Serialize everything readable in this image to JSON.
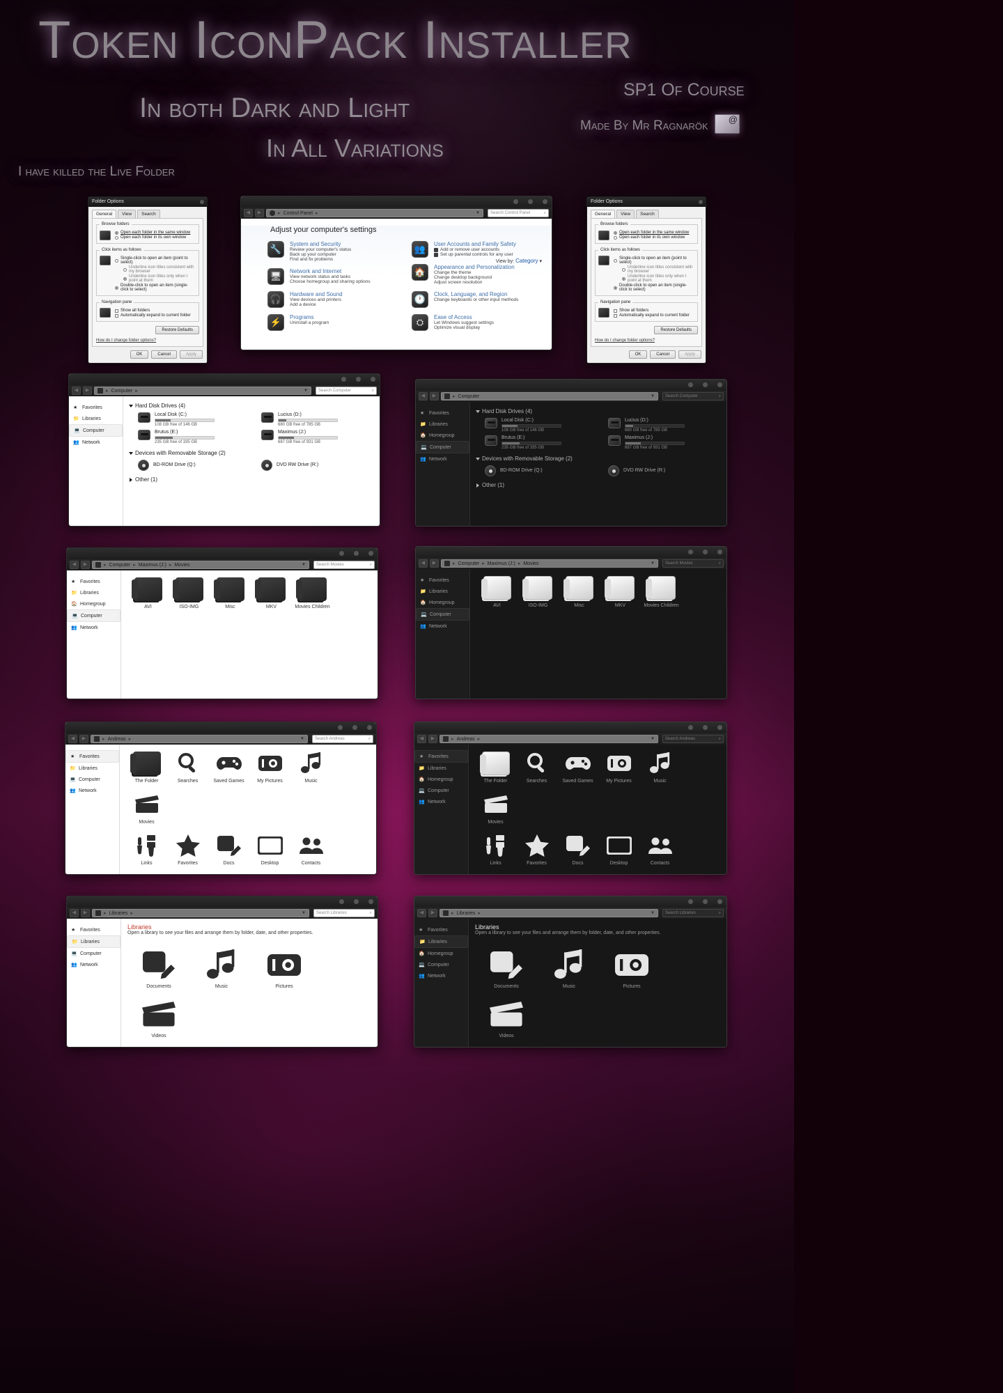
{
  "hero": {
    "title": "Token IconPack Installer",
    "subtitle1": "In both Dark and Light",
    "subtitle2": "In All Variations",
    "sp1": "SP1 Of Course",
    "made_by": "Made By Mr Ragnarök",
    "note": "I have killed the Live Folder"
  },
  "folder_options": {
    "title": "Folder Options",
    "tabs": [
      "General",
      "View",
      "Search"
    ],
    "browse_legend": "Browse folders",
    "browse_opts": [
      "Open each folder in the same window",
      "Open each folder in its own window"
    ],
    "click_legend": "Click items as follows",
    "click_opts": [
      "Single-click to open an item (point to select)",
      "Underline icon titles consistent with my browser",
      "Underline icon titles only when I point at them",
      "Double-click to open an item (single-click to select)"
    ],
    "nav_legend": "Navigation pane",
    "nav_opts": [
      "Show all folders",
      "Automatically expand to current folder"
    ],
    "restore": "Restore Defaults",
    "help": "How do I change folder options?",
    "buttons": [
      "OK",
      "Cancel",
      "Apply"
    ]
  },
  "control_panel": {
    "crumb": "Control Panel",
    "search_placeholder": "Search Control Panel",
    "heading": "Adjust your computer's settings",
    "viewby_label": "View by:",
    "viewby_value": "Category",
    "left": [
      {
        "icon": "wrench-icon",
        "title": "System and Security",
        "links": [
          "Review your computer's status",
          "Back up your computer",
          "Find and fix problems"
        ]
      },
      {
        "icon": "network-icon",
        "title": "Network and Internet",
        "links": [
          "View network status and tasks",
          "Choose homegroup and sharing options"
        ]
      },
      {
        "icon": "headphones-icon",
        "title": "Hardware and Sound",
        "links": [
          "View devices and printers",
          "Add a device"
        ]
      },
      {
        "icon": "bolt-icon",
        "title": "Programs",
        "links": [
          "Uninstall a program"
        ]
      }
    ],
    "right": [
      {
        "icon": "users-icon",
        "title": "User Accounts and Family Safety",
        "links": [
          "Add or remove user accounts",
          "Set up parental controls for any user"
        ],
        "bulleted": true
      },
      {
        "icon": "house-icon",
        "title": "Appearance and Personalization",
        "links": [
          "Change the theme",
          "Change desktop background",
          "Adjust screen resolution"
        ]
      },
      {
        "icon": "clock-icon",
        "title": "Clock, Language, and Region",
        "links": [
          "Change keyboards or other input methods"
        ]
      },
      {
        "icon": "ease-icon",
        "title": "Ease of Access",
        "links": [
          "Let Windows suggest settings",
          "Optimize visual display"
        ]
      }
    ]
  },
  "sidebar_items": [
    {
      "label": "Favorites",
      "icon": "star-icon"
    },
    {
      "label": "Libraries",
      "icon": "library-icon"
    },
    {
      "label": "Homegroup",
      "icon": "house-icon"
    },
    {
      "label": "Computer",
      "icon": "monitor-icon"
    },
    {
      "label": "Network",
      "icon": "people-icon"
    }
  ],
  "computer_window": {
    "crumb": "Computer",
    "search_placeholder": "Search Computer",
    "selected_sidebar": "Computer",
    "group_hdd": "Hard Disk Drives (4)",
    "drives": [
      {
        "name": "Local Disk (C:)",
        "free": "108 GB free of 146 GB",
        "used_pct": 26
      },
      {
        "name": "Lucius (D:)",
        "free": "680 GB free of 785 GB",
        "used_pct": 13
      },
      {
        "name": "Brutus (E:)",
        "free": "235 GB free of 335 GB",
        "used_pct": 30
      },
      {
        "name": "Maximus (J:)",
        "free": "687 GB free of 931 GB",
        "used_pct": 26
      }
    ],
    "group_removable": "Devices with Removable Storage (2)",
    "removable": [
      {
        "name": "BD-ROM Drive (Q:)"
      },
      {
        "name": "DVD RW Drive (R:)"
      }
    ],
    "group_other": "Other (1)"
  },
  "computer_window_sidebar_short": [
    {
      "label": "Favorites"
    },
    {
      "label": "Libraries"
    },
    {
      "label": "Homegroup"
    },
    {
      "label": "Computer"
    },
    {
      "label": "Network"
    }
  ],
  "movies_window": {
    "crumb": "Computer › Maximus (J:) › Movies",
    "crumb_parts": [
      "Computer",
      "Maximus (J:)",
      "Movies"
    ],
    "search_placeholder": "Search Movies",
    "selected_sidebar": "Computer",
    "folders": [
      "AVI",
      "ISO-IMG",
      "Misc",
      "MKV",
      "Movies Children"
    ]
  },
  "andreas_window": {
    "crumb": "Andreas",
    "search_placeholder": "Search Andreas",
    "selected_sidebar": "Favorites",
    "items_row1": [
      {
        "label": "The Folder",
        "icon": "folder-icon"
      },
      {
        "label": "Searches",
        "icon": "magnifier-icon"
      },
      {
        "label": "Saved Games",
        "icon": "gamepad-icon"
      },
      {
        "label": "My Pictures",
        "icon": "camera-icon"
      },
      {
        "label": "Music",
        "icon": "music-note-icon"
      },
      {
        "label": "Movies",
        "icon": "clapperboard-icon"
      }
    ],
    "items_row2": [
      {
        "label": "Links",
        "icon": "plug-icon"
      },
      {
        "label": "Favorites",
        "icon": "star-icon"
      },
      {
        "label": "Docs",
        "icon": "pencil-note-icon"
      },
      {
        "label": "Desktop",
        "icon": "monitor-icon"
      },
      {
        "label": "Contacts",
        "icon": "contacts-icon"
      }
    ]
  },
  "libraries_window": {
    "crumb": "Libraries",
    "search_placeholder": "Search Libraries",
    "selected_sidebar": "Libraries",
    "heading": "Libraries",
    "subheading": "Open a library to see your files and arrange them by folder, date, and other properties.",
    "items": [
      {
        "label": "Documents",
        "icon": "pencil-note-icon"
      },
      {
        "label": "Music",
        "icon": "music-note-icon"
      },
      {
        "label": "Pictures",
        "icon": "camera-icon"
      },
      {
        "label": "Videos",
        "icon": "clapperboard-icon"
      }
    ]
  },
  "colors": {
    "accent_pink": "#a81a6c",
    "background_dark": "#160612",
    "library_red": "#c0392b",
    "link_blue": "#3f6fa8"
  }
}
